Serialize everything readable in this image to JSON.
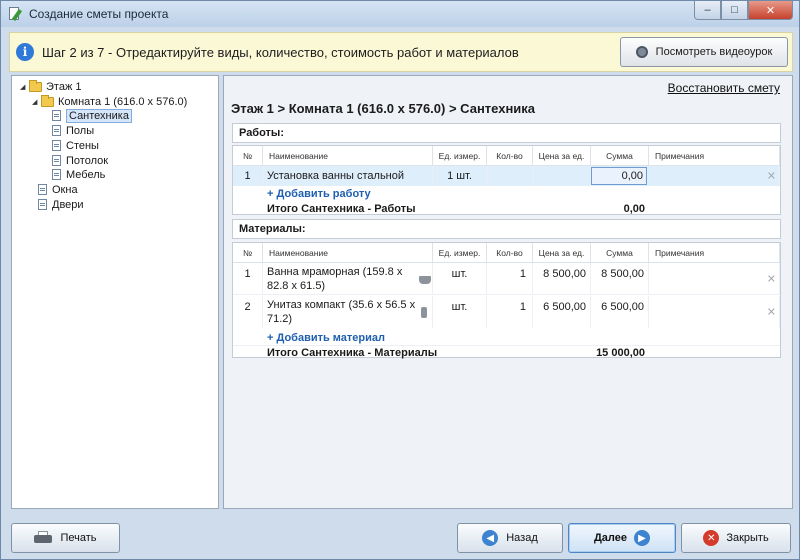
{
  "window": {
    "title": "Создание сметы проекта",
    "min_glyph": "–",
    "max_glyph": "□",
    "close_glyph": "✕"
  },
  "banner": {
    "info_glyph": "i",
    "text": "Шаг 2 из 7 - Отредактируйте виды, количество, стоимость работ и материалов",
    "video_button": "Посмотреть видеоурок"
  },
  "tree": {
    "nodes": [
      {
        "label": "Этаж 1",
        "type": "folder",
        "expanded": true,
        "level": 0
      },
      {
        "label": "Комната 1 (616.0 x 576.0)",
        "type": "folder",
        "expanded": true,
        "level": 1
      },
      {
        "label": "Сантехника",
        "type": "page",
        "selected": true,
        "level": 2
      },
      {
        "label": "Полы",
        "type": "page",
        "level": 2
      },
      {
        "label": "Стены",
        "type": "page",
        "level": 2
      },
      {
        "label": "Потолок",
        "type": "page",
        "level": 2
      },
      {
        "label": "Мебель",
        "type": "page",
        "level": 2
      },
      {
        "label": "Окна",
        "type": "page",
        "level": 1
      },
      {
        "label": "Двери",
        "type": "page",
        "level": 1
      }
    ]
  },
  "main": {
    "restore_link": "Восстановить смету",
    "breadcrumb": "Этаж 1 > Комната 1 (616.0 x 576.0) > Сантехника",
    "columns": {
      "num": "№",
      "name": "Наименование",
      "unit": "Ед. измер.",
      "qty": "Кол-во",
      "price": "Цена за ед.",
      "sum": "Сумма",
      "note": "Примечания"
    },
    "works": {
      "title": "Работы:",
      "rows": [
        {
          "num": "1",
          "name": "Установка ванны стальной",
          "unit": "1 шт.",
          "qty": "",
          "price": "",
          "sum": "0,00",
          "note": ""
        }
      ],
      "add_link": "+ Добавить работу",
      "total_label": "Итого Сантехника - Работы",
      "total_value": "0,00"
    },
    "materials": {
      "title": "Материалы:",
      "rows": [
        {
          "num": "1",
          "name_line1": "Ванна мраморная (159.8 x",
          "name_line2": "82.8 x 61.5)",
          "icon": "bathtub-icon",
          "unit": "шт.",
          "qty": "1",
          "price": "8 500,00",
          "sum": "8 500,00",
          "note": ""
        },
        {
          "num": "2",
          "name_line1": "Унитаз компакт (35.6 x 56.5 x",
          "name_line2": "71.2)",
          "icon": "toilet-icon",
          "unit": "шт.",
          "qty": "1",
          "price": "6 500,00",
          "sum": "6 500,00",
          "note": ""
        }
      ],
      "add_link": "+ Добавить материал",
      "total_label": "Итого Сантехника - Материалы",
      "total_value": "15 000,00"
    },
    "delete_glyph": "✕"
  },
  "footer": {
    "print": "Печать",
    "back": "Назад",
    "next": "Далее",
    "close": "Закрыть",
    "back_glyph": "◀",
    "next_glyph": "▶",
    "close_glyph": "✕"
  },
  "colors": {
    "window_bg": "#cfdcec",
    "banner_bg": "#fbf8d6",
    "link": "#1f5fb0",
    "highlight_row": "#dfeefb",
    "close_red": "#d43b2c"
  }
}
